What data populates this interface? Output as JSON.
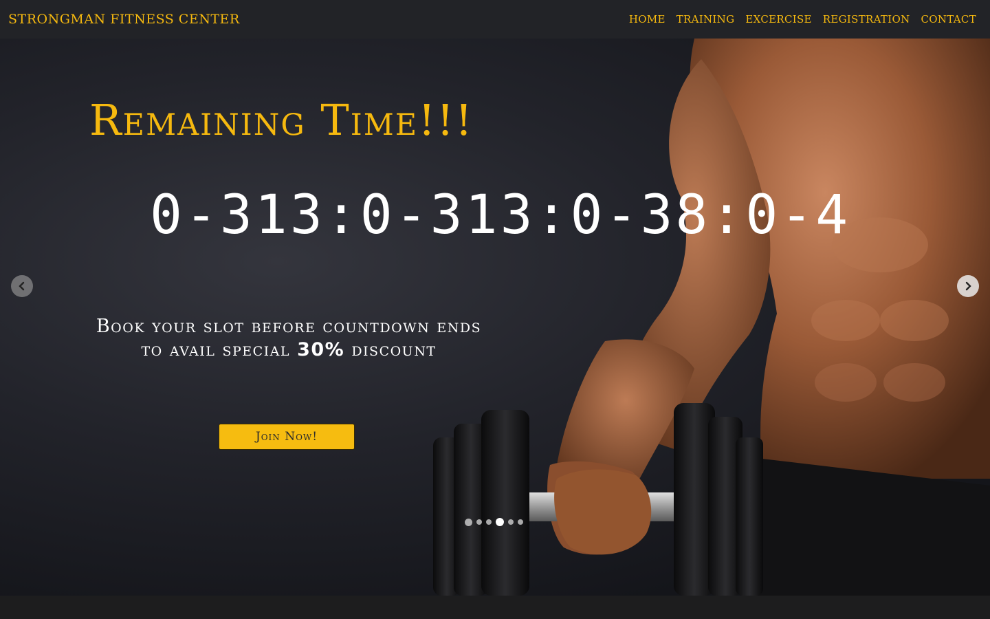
{
  "brand": "STRONGMAN FITNESS CENTER",
  "nav": {
    "items": [
      "HOME",
      "TRAINING",
      "EXCERCISE",
      "REGISTRATION",
      "CONTACT"
    ]
  },
  "hero": {
    "title": "Remaining Time!!!",
    "countdown": "0-313:0-313:0-38:0-4",
    "promo_line1": "Book your slot before countdown ends",
    "promo_line2_prefix": "to avail special ",
    "promo_highlight": "30%",
    "promo_line2_suffix": " discount",
    "join_button": "Join Now!"
  },
  "carousel": {
    "slide_count": 6,
    "active_index": 3,
    "prev_icon": "chevron-left-icon",
    "next_icon": "chevron-right-icon"
  },
  "colors": {
    "accent": "#f6b90f",
    "navbar_bg": "#222327",
    "hero_bg": "#1e1f25"
  }
}
